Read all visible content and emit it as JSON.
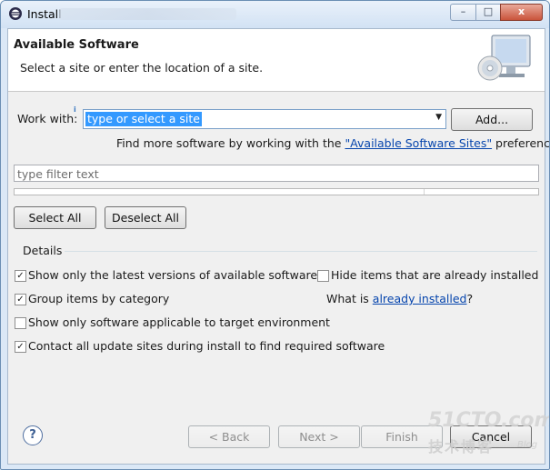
{
  "window": {
    "title": "Install",
    "minimize": "–",
    "maximize": "□",
    "close": "x"
  },
  "header": {
    "title": "Available Software",
    "subtitle": "Select a site or enter the location of a site."
  },
  "work_with": {
    "label": "Work with:",
    "value": "type or select a site",
    "add_button": "Add..."
  },
  "find_more": {
    "prefix": "Find more software by working with the ",
    "link": "\"Available Software Sites\"",
    "suffix": " preferences."
  },
  "filter": {
    "placeholder": "type filter text"
  },
  "buttons": {
    "select_all": "Select All",
    "deselect_all": "Deselect All"
  },
  "details": {
    "legend": "Details",
    "options": [
      {
        "label": "Show only the latest versions of available software",
        "checked": true
      },
      {
        "label": "Group items by category",
        "checked": true
      },
      {
        "label": "Show only software applicable to target environment",
        "checked": false
      },
      {
        "label": "Contact all update sites during install to find required software",
        "checked": true
      }
    ],
    "hide_installed": {
      "label": "Hide items that are already installed",
      "checked": false
    },
    "what_is": {
      "prefix": "What is ",
      "link": "already installed",
      "suffix": "?"
    }
  },
  "footer": {
    "help": "?",
    "back": "< Back",
    "next": "Next >",
    "finish": "Finish",
    "cancel": "Cancel"
  },
  "watermark": {
    "line1": "51CTO.com",
    "line2": "技术博客",
    "line3": "Blog"
  }
}
